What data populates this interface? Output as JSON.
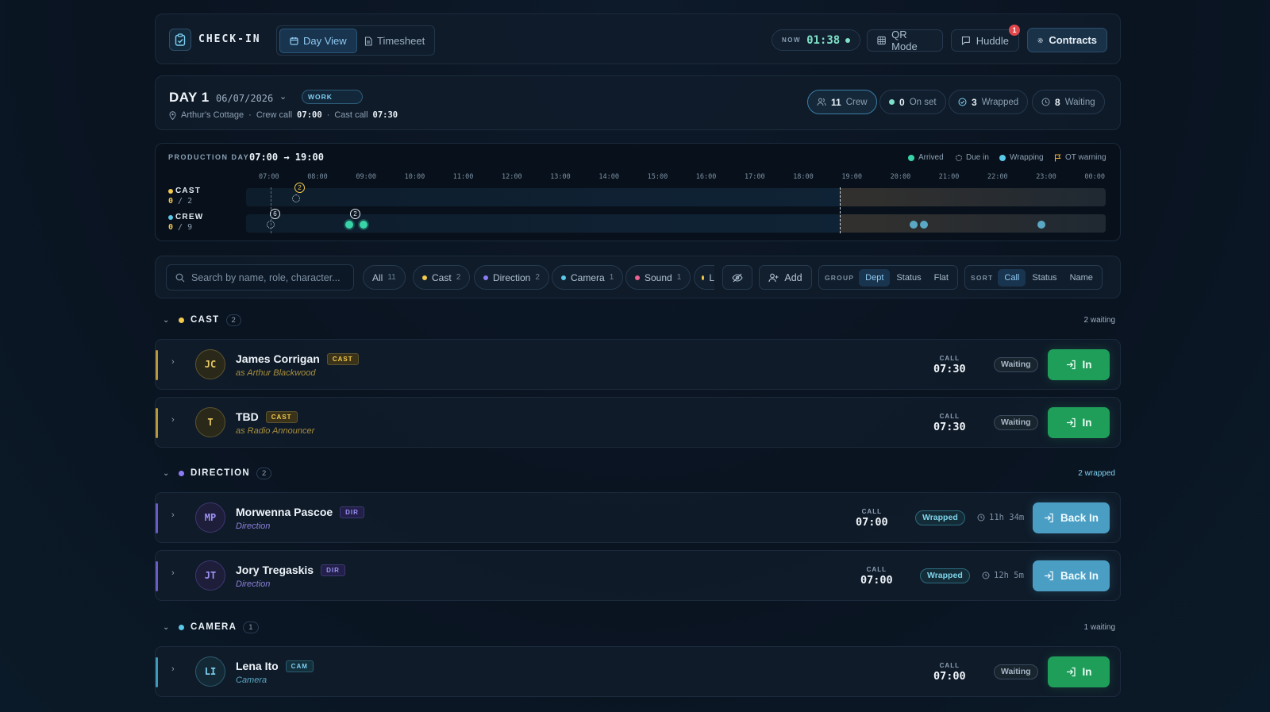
{
  "app": {
    "title": "CHECK-IN"
  },
  "view_tabs": [
    {
      "label": "Day View",
      "active": true
    },
    {
      "label": "Timesheet",
      "active": false
    }
  ],
  "topbar": {
    "now_label": "NOW",
    "now_time": "01:38",
    "qr_label": "QR Mode",
    "huddle_label": "Huddle",
    "huddle_badge": "1",
    "contracts_label": "Contracts"
  },
  "day": {
    "title": "DAY 1",
    "date": "06/07/2026",
    "type_badge": "WORK",
    "location": "Arthur's Cottage",
    "crew_call_label": "Crew call",
    "crew_call": "07:00",
    "cast_call_label": "Cast call",
    "cast_call": "07:30",
    "sep": "·"
  },
  "stats": [
    {
      "value": "11",
      "label": "Crew",
      "icon": "people-icon"
    },
    {
      "value": "0",
      "label": "On set",
      "icon": "dot-icon"
    },
    {
      "value": "3",
      "label": "Wrapped",
      "icon": "check-circle-icon"
    },
    {
      "value": "8",
      "label": "Waiting",
      "icon": "clock-icon"
    }
  ],
  "timeline": {
    "title": "PRODUCTION DAY",
    "range": "07:00 → 19:00",
    "legend": [
      {
        "label": "Arrived",
        "color": "#39d3a8"
      },
      {
        "label": "Due in",
        "color": "#d0dbe6"
      },
      {
        "label": "Wrapping",
        "color": "#5aa8c4"
      },
      {
        "label": "OT warning",
        "color": "#e8a83a"
      }
    ],
    "hours": [
      "07:00",
      "08:00",
      "09:00",
      "10:00",
      "11:00",
      "12:00",
      "13:00",
      "14:00",
      "15:00",
      "16:00",
      "17:00",
      "18:00",
      "19:00",
      "20:00",
      "21:00",
      "22:00",
      "23:00",
      "00:00"
    ],
    "rows": [
      {
        "label": "CAST",
        "arrived": "0",
        "total": "2",
        "color": "#f2c94c",
        "cluster": "2"
      },
      {
        "label": "CREW",
        "arrived": "0",
        "total": "9",
        "color": "#5ac8e8",
        "cluster_due": "6",
        "cluster_arrived": "2"
      }
    ]
  },
  "filters": {
    "search_placeholder": "Search by name, role, character...",
    "chips": [
      {
        "label": "All",
        "count": "11",
        "color": ""
      },
      {
        "label": "Cast",
        "count": "2",
        "color": "#f2c94c"
      },
      {
        "label": "Direction",
        "count": "2",
        "color": "#8b7cf6"
      },
      {
        "label": "Camera",
        "count": "1",
        "color": "#5ac8e8"
      },
      {
        "label": "Sound",
        "count": "1",
        "color": "#f06292"
      },
      {
        "label": "L",
        "count": "",
        "color": "#f2c94c"
      }
    ],
    "add_label": "Add",
    "group_label": "GROUP",
    "group_options": [
      "Dept",
      "Status",
      "Flat"
    ],
    "sort_label": "SORT",
    "sort_options": [
      "Call",
      "Status",
      "Name"
    ]
  },
  "groups": [
    {
      "name": "CAST",
      "count": "2",
      "status": "2 waiting",
      "color": "#f2c94c",
      "people": [
        {
          "initials": "JC",
          "name": "James Corrigan",
          "tag": "CAST",
          "role": "as Arthur Blackwood",
          "call_label": "CALL",
          "call": "07:30",
          "status": "Waiting",
          "action": "In"
        },
        {
          "initials": "T",
          "name": "TBD",
          "tag": "CAST",
          "role": "as Radio Announcer",
          "call_label": "CALL",
          "call": "07:30",
          "status": "Waiting",
          "action": "In"
        }
      ]
    },
    {
      "name": "DIRECTION",
      "count": "2",
      "status": "2 wrapped",
      "color": "#8b7cf6",
      "people": [
        {
          "initials": "MP",
          "name": "Morwenna Pascoe",
          "tag": "DIR",
          "role": "Direction",
          "call_label": "CALL",
          "call": "07:00",
          "status": "Wrapped",
          "elapsed": "11h 34m",
          "action": "Back In"
        },
        {
          "initials": "JT",
          "name": "Jory Tregaskis",
          "tag": "DIR",
          "role": "Direction",
          "call_label": "CALL",
          "call": "07:00",
          "status": "Wrapped",
          "elapsed": "12h 5m",
          "action": "Back In"
        }
      ]
    },
    {
      "name": "CAMERA",
      "count": "1",
      "status": "1 waiting",
      "color": "#5ac8e8",
      "people": [
        {
          "initials": "LI",
          "name": "Lena Ito",
          "tag": "CAM",
          "role": "Camera",
          "call_label": "CALL",
          "call": "07:00",
          "status": "Waiting",
          "action": "In"
        }
      ]
    }
  ]
}
